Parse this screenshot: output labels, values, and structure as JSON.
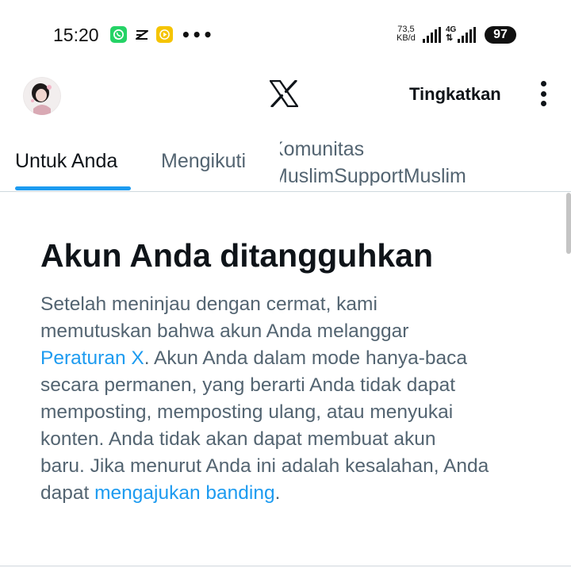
{
  "status_bar": {
    "time": "15:20",
    "overflow": "•••",
    "net_speed_value": "73,5",
    "net_speed_unit": "KB/d",
    "network_type": "4G",
    "battery": "97",
    "icons": [
      "whatsapp-icon",
      "capcut-icon",
      "yellow-app-icon",
      "wifi-signal-icon",
      "cell-signal-icon"
    ]
  },
  "top_bar": {
    "logo": "x-logo",
    "upgrade_label": "Tingkatkan",
    "menu_icon": "kebab-menu-icon"
  },
  "tabs": [
    {
      "label": "Untuk Anda",
      "selected": true
    },
    {
      "label": "Mengikuti",
      "selected": false
    },
    {
      "label_line1": "Komunitas",
      "label_line2": "MuslimSupportMuslim",
      "selected": false
    }
  ],
  "notice": {
    "title": "Akun Anda ditangguhkan",
    "line1": "Setelah meninjau dengan cermat, kami",
    "line2": "memutuskan bahwa akun Anda melanggar",
    "rules_link": "Peraturan X",
    "line3_rest": ". Akun Anda dalam mode hanya-baca",
    "line4": "secara permanen, yang berarti Anda tidak dapat",
    "line5": "memposting, memposting ulang, atau menyukai",
    "line6": "konten. Anda tidak akan dapat membuat akun",
    "line7": "baru. Jika menurut Anda ini adalah kesalahan, Anda",
    "line8_start": "dapat ",
    "appeal_link": "mengajukan banding",
    "line8_end": "."
  },
  "colors": {
    "accent": "#1d9bf0",
    "text_primary": "#0f1419",
    "text_secondary": "#536471",
    "divider": "#cfd9de"
  }
}
